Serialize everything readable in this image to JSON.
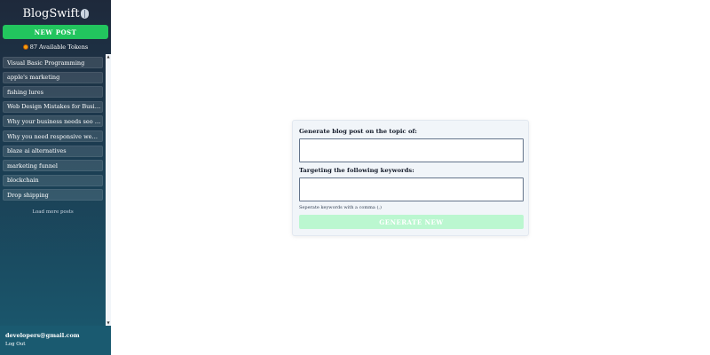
{
  "brand": {
    "name": "BlogSwift",
    "icon": "brain-icon"
  },
  "sidebar": {
    "new_post_label": "NEW POST",
    "tokens_text": "87 Available Tokens",
    "token_icon": "coin-stack-icon",
    "posts": [
      "Visual Basic Programming",
      "apple's marketing",
      "fishing lures",
      "Web Design Mistakes for Business Owners",
      "Why your business needs seo and how it helps",
      "Why you need responsive web design for your business",
      "blaze ai alternatives",
      "marketing funnel",
      "blockchain",
      "Drop shipping"
    ],
    "load_more_label": "Load more posts",
    "account": {
      "email": "developers@gmail.com",
      "logout_label": "Log Out"
    }
  },
  "form": {
    "topic_label": "Generate blog post on the topic of:",
    "topic_value": "",
    "keywords_label": "Targeting the following keywords:",
    "keywords_value": "",
    "keywords_hint": "Seperate keywords with a comma (,)",
    "submit_label": "GENERATE NEW"
  },
  "colors": {
    "accent": "#22c55e",
    "accent_disabled": "#bbf7d0",
    "sidebar_top": "#1e293b",
    "sidebar_bottom": "#1a5a70"
  }
}
